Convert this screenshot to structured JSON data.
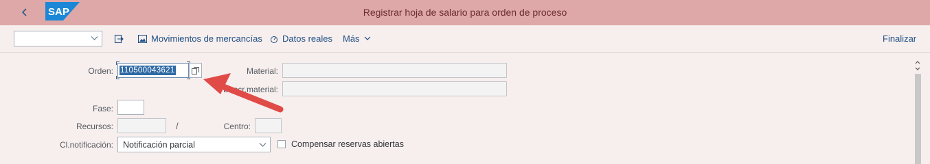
{
  "shell": {
    "logo_text": "SAP",
    "title": "Registrar hoja de salario para orden de proceso"
  },
  "toolbar": {
    "variant_value": "",
    "goods_movements_label": "Movimientos de mercancías",
    "actual_data_label": "Datos reales",
    "more_label": "Más",
    "finish_label": "Finalizar"
  },
  "form": {
    "order_label": "Orden:",
    "order_value": "110500043621",
    "material_label": "Material:",
    "material_value": "",
    "material_desc_label": "Descr.material:",
    "material_desc_value": "",
    "phase_label": "Fase:",
    "phase_value": "",
    "resources_label": "Recursos:",
    "resources_value": "",
    "separator": "/",
    "plant_label": "Centro:",
    "plant_value": "",
    "confirmation_type_label": "Cl.notificación:",
    "confirmation_type_value": "Notificación parcial",
    "compensate_label": "Compensar reservas abiertas",
    "compensate_checked": false
  },
  "colors": {
    "shell_bg": "#dfa8a8",
    "page_bg": "#f7eeee",
    "link_blue": "#1d4f82",
    "annotation_arrow": "#e04a47"
  },
  "icons": {
    "back": "chevron-left-icon",
    "value_help": "value-help-icon",
    "export": "export-icon",
    "image": "image-icon",
    "actual_data": "gauge-icon",
    "more_dropdown": "chevron-down-icon"
  }
}
